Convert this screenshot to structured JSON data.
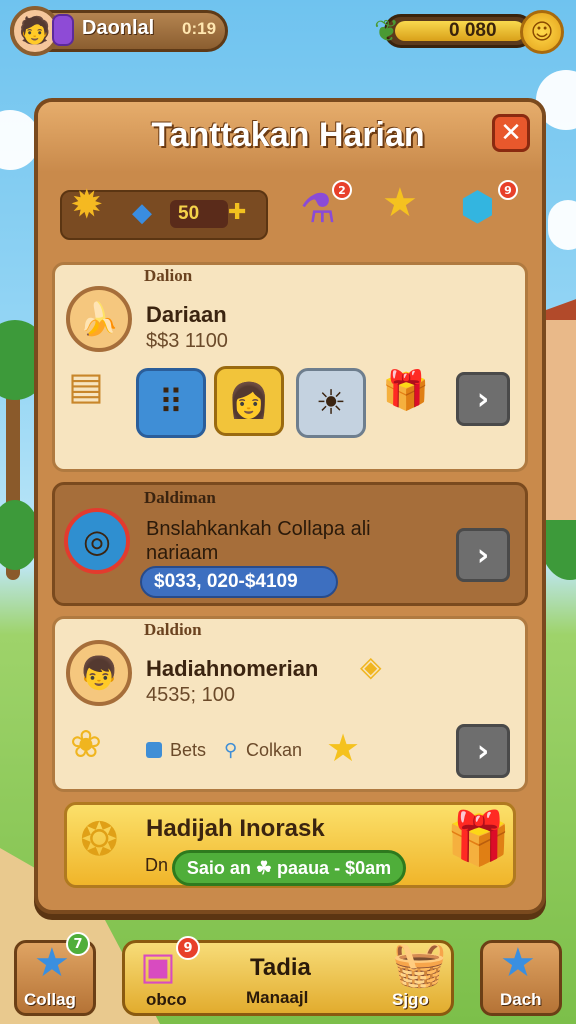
{
  "header": {
    "player_name": "Daonlal",
    "player_level": "0:19",
    "coin_value": "0 080"
  },
  "panel": {
    "title": "Tanttakan Harian",
    "resource_value": "50"
  },
  "cards": [
    {
      "head": "Dalion",
      "title": "Dariaan",
      "sub": "$$3 1100"
    },
    {
      "head": "Daldiman",
      "title": "Bnslahkankah Collapa ali",
      "title2": "nariaam",
      "reward_pill": "$033, 020-$4109"
    },
    {
      "head": "Daldion",
      "title": "Hadiahnomerian",
      "sub": "4535; 100",
      "tag1": "Bets",
      "tag2": "Colkan"
    }
  ],
  "special": {
    "title": "Hadijah Inorask",
    "label": "Dn",
    "pill": "Saio an ☘ paaua - $0am"
  },
  "bottom_nav": {
    "left_label": "Collag",
    "left_badge": "7",
    "center_title": "Tadia",
    "center_sub": "Manaajl",
    "center_left_label": "obco",
    "center_left_badge": "9",
    "center_right_label": "Sjgo",
    "right_label": "Dach"
  },
  "notifications": {
    "potion_badge": "2",
    "gem_badge": "9"
  }
}
